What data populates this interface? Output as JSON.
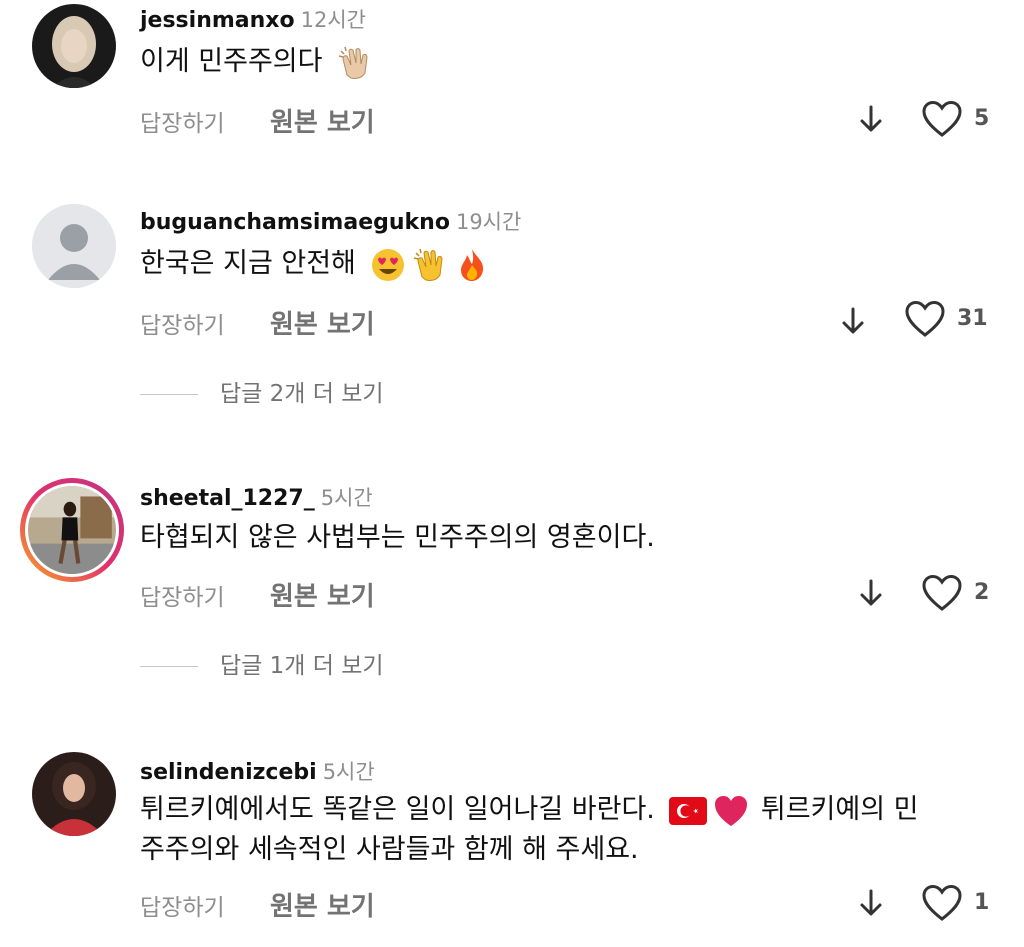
{
  "comments": [
    {
      "username": "jessinmanxo",
      "time": "12시간",
      "text": "이게 민주주의다",
      "emoji": "clapping-hands-icon",
      "reply_label": "답장하기",
      "original_label": "원본 보기",
      "likes": "5"
    },
    {
      "username": "buguanchamsimaegukno",
      "time": "19시간",
      "text": "한국은 지금 안전해",
      "emoji": [
        "heart-eyes-icon",
        "clapping-hands-icon",
        "fire-icon"
      ],
      "reply_label": "답장하기",
      "original_label": "원본 보기",
      "likes": "31",
      "more_replies": "답글 2개 더 보기"
    },
    {
      "username": "sheetal_1227_",
      "time": "5시간",
      "text": "타협되지 않은 사법부는 민주주의의 영혼이다.",
      "reply_label": "답장하기",
      "original_label": "원본 보기",
      "likes": "2",
      "more_replies": "답글 1개 더 보기"
    },
    {
      "username": "selindenizcebi",
      "time": "5시간",
      "text_line1": "튀르키예에서도 똑같은 일이 일어나길 바란다.",
      "text_line1_tail": "튀르키예의 민",
      "text_line2": "주주의와 세속적인 사람들과 함께 해 주세요.",
      "emoji": [
        "turkey-flag-icon",
        "red-heart-icon"
      ],
      "reply_label": "답장하기",
      "original_label": "원본 보기",
      "likes": "1"
    }
  ],
  "colors": {
    "secondary_text": "#8e8e8e",
    "story_ring_start": "#f9a825",
    "story_ring_end": "#c13584"
  }
}
